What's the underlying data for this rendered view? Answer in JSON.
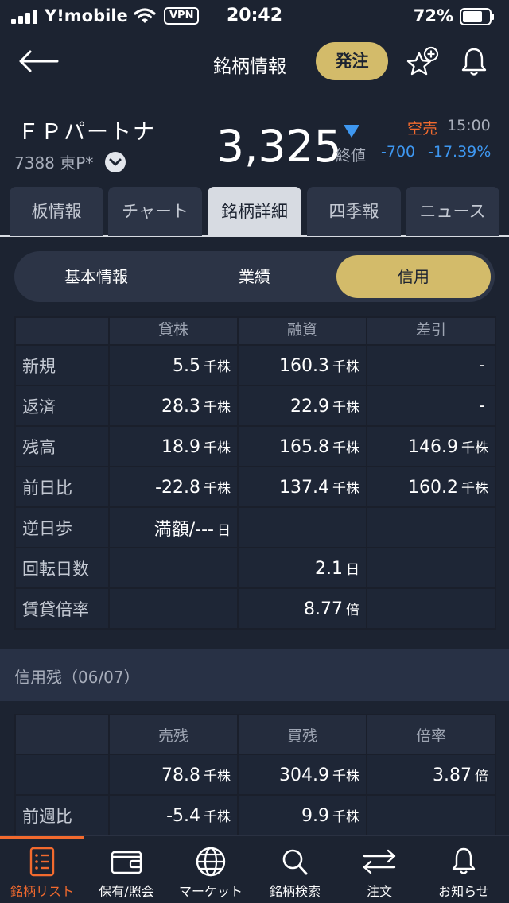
{
  "status_bar": {
    "carrier": "Y!mobile",
    "vpn": "VPN",
    "time": "20:42",
    "battery": "72%"
  },
  "nav": {
    "title": "銘柄情報",
    "order_button": "発注"
  },
  "stock": {
    "name": "ＦＰパートナ",
    "code": "7388",
    "market": "東P*",
    "price": "3,325",
    "price_label": "終値",
    "margin_type": "空売",
    "time": "15:00",
    "change": "-700",
    "change_pct": "-17.39%"
  },
  "tabs": [
    "板情報",
    "チャート",
    "銘柄詳細",
    "四季報",
    "ニュース"
  ],
  "active_tab_index": 2,
  "segments": [
    "基本情報",
    "業績",
    "信用"
  ],
  "active_segment_index": 2,
  "margin_table": {
    "columns": [
      "",
      "貸株",
      "融資",
      "差引"
    ],
    "rows": [
      {
        "label": "新規",
        "cells": [
          [
            "5.5",
            "千株"
          ],
          [
            "160.3",
            "千株"
          ],
          [
            "-",
            ""
          ]
        ]
      },
      {
        "label": "返済",
        "cells": [
          [
            "28.3",
            "千株"
          ],
          [
            "22.9",
            "千株"
          ],
          [
            "-",
            ""
          ]
        ]
      },
      {
        "label": "残高",
        "cells": [
          [
            "18.9",
            "千株"
          ],
          [
            "165.8",
            "千株"
          ],
          [
            "146.9",
            "千株"
          ]
        ]
      },
      {
        "label": "前日比",
        "cells": [
          [
            "-22.8",
            "千株"
          ],
          [
            "137.4",
            "千株"
          ],
          [
            "160.2",
            "千株"
          ]
        ]
      },
      {
        "label": "逆日歩",
        "cells": [
          [
            "満額/---",
            "日"
          ],
          [
            "",
            ""
          ],
          [
            "",
            ""
          ]
        ]
      },
      {
        "label": "回転日数",
        "cells": [
          [
            "",
            ""
          ],
          [
            "2.1",
            "日"
          ],
          [
            "",
            ""
          ]
        ]
      },
      {
        "label": "賃貸倍率",
        "cells": [
          [
            "",
            ""
          ],
          [
            "8.77",
            "倍"
          ],
          [
            "",
            ""
          ]
        ]
      }
    ]
  },
  "credit_section": {
    "title": "信用残（06/07）"
  },
  "credit_table": {
    "columns": [
      "",
      "売残",
      "買残",
      "倍率"
    ],
    "rows": [
      {
        "label": "",
        "cells": [
          [
            "78.8",
            "千株"
          ],
          [
            "304.9",
            "千株"
          ],
          [
            "3.87",
            "倍"
          ]
        ]
      },
      {
        "label": "前週比",
        "cells": [
          [
            "-5.4",
            "千株"
          ],
          [
            "9.9",
            "千株"
          ],
          [
            "",
            ""
          ]
        ]
      }
    ]
  },
  "bottom_nav": [
    {
      "label": "銘柄リスト",
      "icon": "list-icon"
    },
    {
      "label": "保有/照会",
      "icon": "wallet-icon"
    },
    {
      "label": "マーケット",
      "icon": "globe-icon"
    },
    {
      "label": "銘柄検索",
      "icon": "search-icon"
    },
    {
      "label": "注文",
      "icon": "swap-icon"
    },
    {
      "label": "お知らせ",
      "icon": "bell-icon"
    }
  ],
  "active_bottom_index": 0,
  "colors": {
    "accent_gold": "#d3bb6a",
    "down_blue": "#3e97f0",
    "orange": "#f26a2e",
    "background": "#1c2331"
  }
}
